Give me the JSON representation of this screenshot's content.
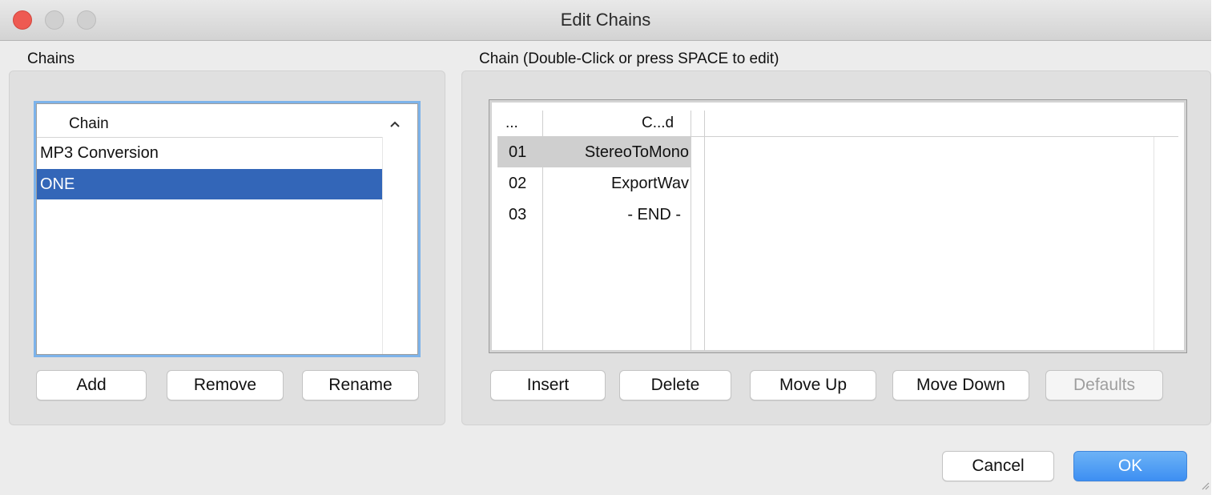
{
  "window": {
    "title": "Edit Chains"
  },
  "chains_section": {
    "label": "Chains",
    "column_header": "Chain",
    "sort_icon": "chevron-up-icon",
    "items": [
      {
        "label": "MP3 Conversion",
        "selected": false
      },
      {
        "label": "ONE",
        "selected": true
      }
    ],
    "buttons": {
      "add": "Add",
      "remove": "Remove",
      "rename": "Rename"
    }
  },
  "chain_section": {
    "label": "Chain (Double-Click or press SPACE to edit)",
    "columns": {
      "number": "...",
      "command": "C...d"
    },
    "rows": [
      {
        "num": "01",
        "command": "StereoToMono",
        "selected": true
      },
      {
        "num": "02",
        "command": "ExportWav",
        "selected": false
      },
      {
        "num": "03",
        "command": "- END -",
        "selected": false
      }
    ],
    "buttons": {
      "insert": "Insert",
      "delete": "Delete",
      "move_up": "Move Up",
      "move_down": "Move Down",
      "defaults": "Defaults"
    }
  },
  "footer": {
    "cancel": "Cancel",
    "ok": "OK"
  },
  "colors": {
    "selection": "#3366b8",
    "accent": "#3d8ff2",
    "close": "#ee5a52"
  }
}
